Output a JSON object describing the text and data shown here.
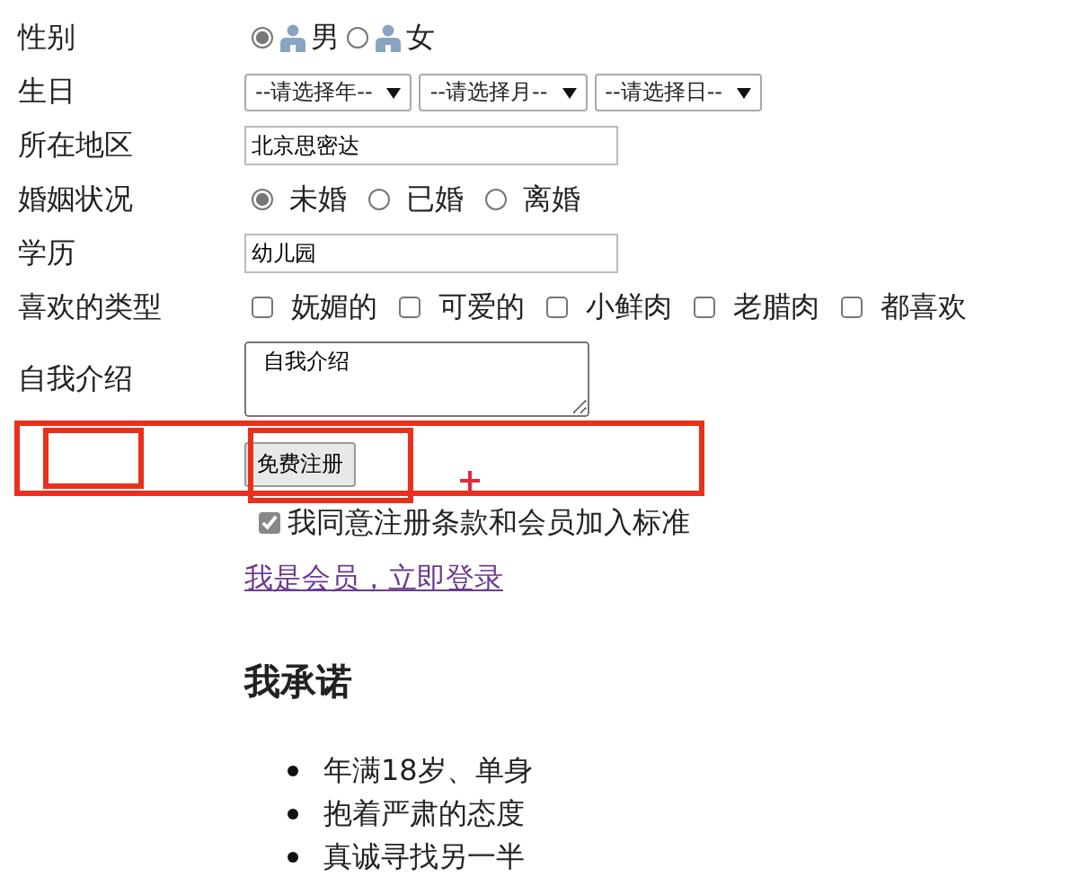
{
  "form": {
    "rows": [
      {
        "label": "性别",
        "kind": "radio-icons",
        "options": [
          {
            "text": "男",
            "selected": true
          },
          {
            "text": "女",
            "selected": false
          }
        ]
      },
      {
        "label": "生日",
        "kind": "selects",
        "options": [
          {
            "text": "--请选择年--"
          },
          {
            "text": "--请选择月--"
          },
          {
            "text": "--请选择日--"
          }
        ]
      },
      {
        "label": "所在地区",
        "kind": "text",
        "value": "北京思密达"
      },
      {
        "label": "婚姻状况",
        "kind": "radio",
        "options": [
          {
            "text": "未婚",
            "selected": true
          },
          {
            "text": "已婚",
            "selected": false
          },
          {
            "text": "离婚",
            "selected": false
          }
        ]
      },
      {
        "label": "学历",
        "kind": "text",
        "value": "幼儿园"
      },
      {
        "label": "喜欢的类型",
        "kind": "checkbox",
        "options": [
          {
            "text": "妩媚的",
            "checked": false
          },
          {
            "text": "可爱的",
            "checked": false
          },
          {
            "text": "小鲜肉",
            "checked": false
          },
          {
            "text": "老腊肉",
            "checked": false
          },
          {
            "text": "都喜欢",
            "checked": false
          }
        ]
      },
      {
        "label": "自我介绍",
        "kind": "textarea",
        "value": "  自我介绍"
      },
      {
        "kind": "button",
        "text": "免费注册"
      },
      {
        "kind": "agree",
        "text": "我同意注册条款和会员加入标准",
        "checked": true
      },
      {
        "kind": "link",
        "text": "我是会员，立即登录"
      }
    ]
  },
  "promise": {
    "title": "我承诺",
    "items": [
      "年满18岁、单身",
      "抱着严肃的态度",
      "真诚寻找另一半"
    ]
  }
}
